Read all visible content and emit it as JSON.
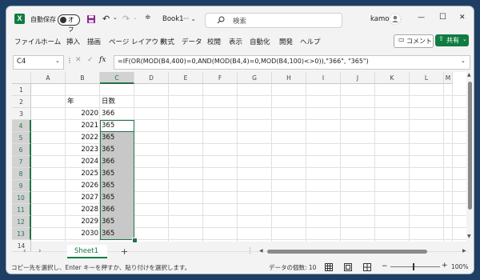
{
  "titlebar": {
    "autosave_label": "自動保存",
    "autosave_state": "オフ",
    "book_name": "Book1",
    "book_suffix": "··· ⌄",
    "search_placeholder": "検索",
    "user_name": "kamo",
    "minimize": "—",
    "maximize": "☐",
    "close": "✕"
  },
  "menu": {
    "items": [
      "ファイル",
      "ホーム",
      "挿入",
      "描画",
      "ページ レイアウト",
      "数式",
      "データ",
      "校閲",
      "表示",
      "自動化",
      "開発",
      "ヘルプ"
    ],
    "comment_label": "コメント",
    "share_label": "共有"
  },
  "formula_bar": {
    "name_box": "C4",
    "formula": "=IF(OR(MOD(B4,400)=0,AND(MOD(B4,4)=0,MOD(B4,100)<>0)),\"366\", \"365\")",
    "fx": "fx"
  },
  "sheet": {
    "columns": [
      "A",
      "B",
      "C",
      "D",
      "E",
      "F",
      "G",
      "H",
      "I",
      "J",
      "K",
      "L",
      "M"
    ],
    "rows": [
      "1",
      "2",
      "3",
      "4",
      "5",
      "6",
      "7",
      "8",
      "9",
      "10",
      "11",
      "12",
      "13",
      "14"
    ],
    "header_b": "年",
    "header_c": "日数",
    "years": [
      "2020",
      "2021",
      "2022",
      "2023",
      "2024",
      "2025",
      "2026",
      "2027",
      "2028",
      "2029",
      "2030"
    ],
    "days": [
      "366",
      "365",
      "365",
      "365",
      "366",
      "365",
      "365",
      "365",
      "366",
      "365",
      "365"
    ],
    "active_cell": "C4",
    "selection_color": "#c8c8c8",
    "active_border_color": "#217346"
  },
  "tabs": {
    "sheet_name": "Sheet1",
    "add": "+"
  },
  "status": {
    "message": "コピー先を選択し、Enter キーを押すか、貼り付けを選択します。",
    "count": "データの個数: 10",
    "zoom": "100%"
  }
}
